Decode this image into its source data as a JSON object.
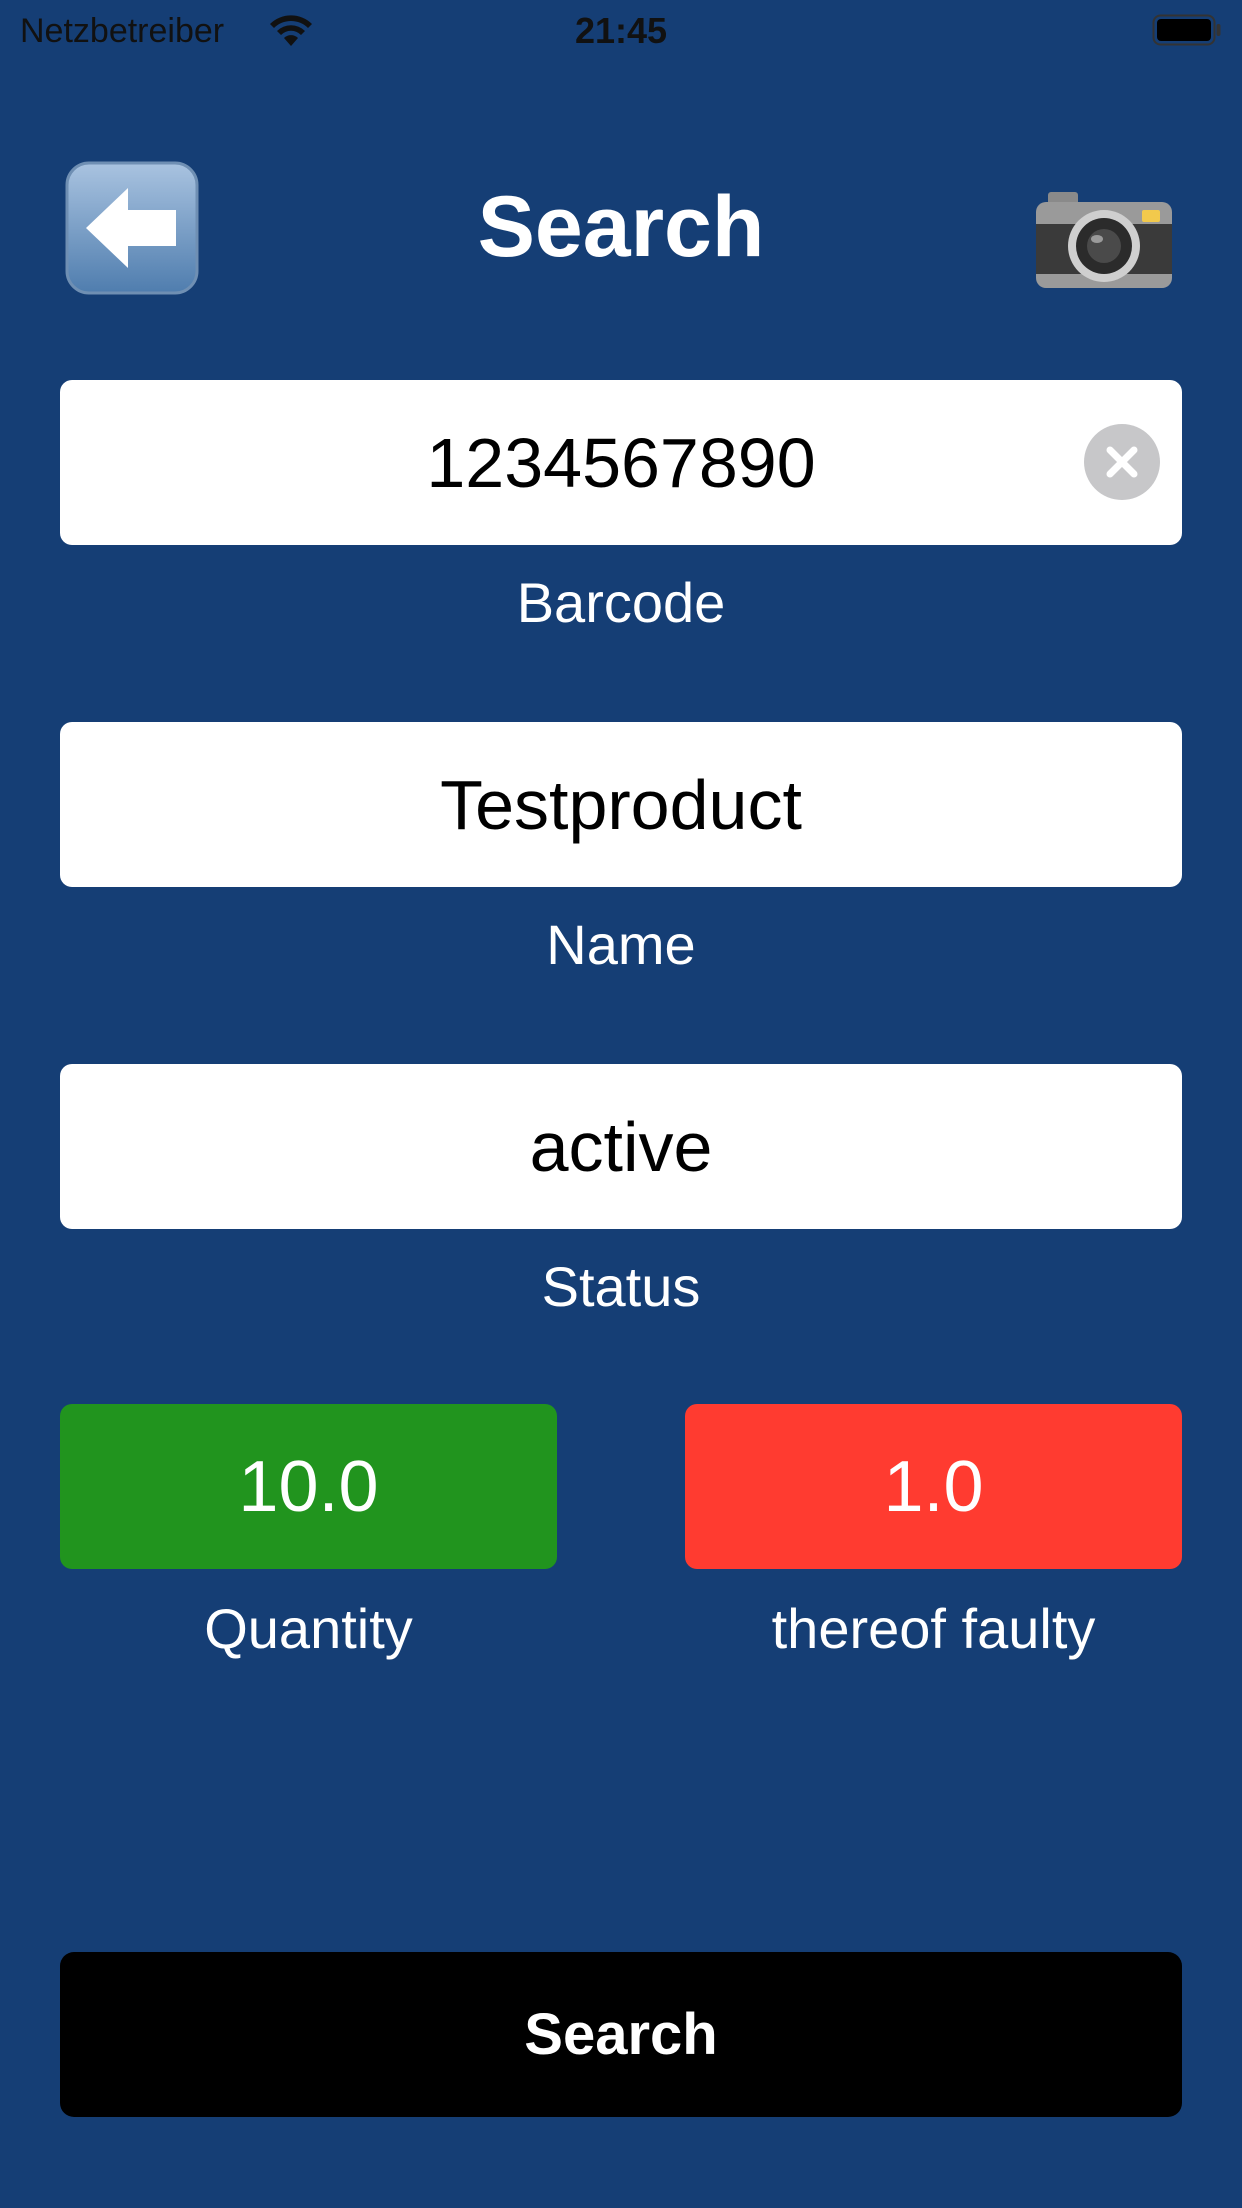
{
  "status_bar": {
    "carrier": "Netzbetreiber",
    "time": "21:45",
    "wifi_icon": "wifi-icon",
    "battery_icon": "battery-icon"
  },
  "header": {
    "title": "Search",
    "back_icon": "back-arrow-icon",
    "camera_icon": "camera-icon"
  },
  "form": {
    "barcode": {
      "value": "1234567890",
      "label": "Barcode",
      "clear_icon": "clear-icon"
    },
    "name": {
      "value": "Testproduct",
      "label": "Name"
    },
    "status": {
      "value": "active",
      "label": "Status"
    },
    "quantity": {
      "value": "10.0",
      "label": "Quantity",
      "color": "#21941e"
    },
    "faulty": {
      "value": "1.0",
      "label": "thereof faulty",
      "color": "#ff3b30"
    }
  },
  "actions": {
    "search_label": "Search"
  },
  "colors": {
    "background": "#153e75",
    "field": "#ffffff",
    "button": "#000000"
  }
}
